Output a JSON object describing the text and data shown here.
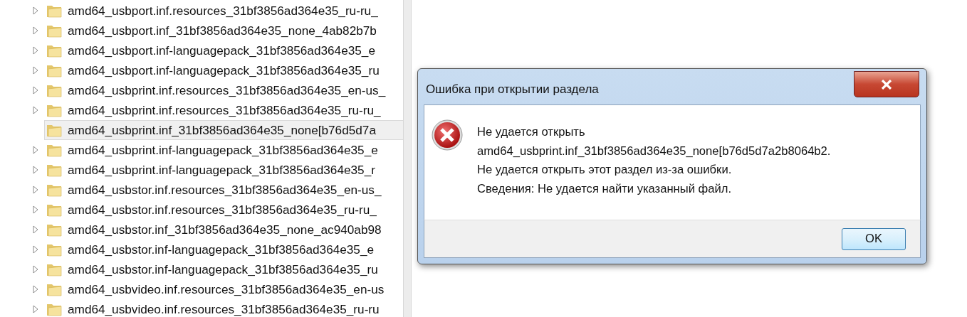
{
  "tree": {
    "items": [
      {
        "label": "amd64_usbport.inf.resources_31bf3856ad364e35_ru-ru_",
        "has_children": true,
        "selected": false
      },
      {
        "label": "amd64_usbport.inf_31bf3856ad364e35_none_4ab82b7b",
        "has_children": true,
        "selected": false
      },
      {
        "label": "amd64_usbport.inf-languagepack_31bf3856ad364e35_e",
        "has_children": true,
        "selected": false
      },
      {
        "label": "amd64_usbport.inf-languagepack_31bf3856ad364e35_ru",
        "has_children": true,
        "selected": false
      },
      {
        "label": "amd64_usbprint.inf.resources_31bf3856ad364e35_en-us_",
        "has_children": true,
        "selected": false
      },
      {
        "label": "amd64_usbprint.inf.resources_31bf3856ad364e35_ru-ru_",
        "has_children": true,
        "selected": false
      },
      {
        "label": "amd64_usbprint.inf_31bf3856ad364e35_none[b76d5d7a",
        "has_children": false,
        "selected": true
      },
      {
        "label": "amd64_usbprint.inf-languagepack_31bf3856ad364e35_e",
        "has_children": true,
        "selected": false
      },
      {
        "label": "amd64_usbprint.inf-languagepack_31bf3856ad364e35_r",
        "has_children": true,
        "selected": false
      },
      {
        "label": "amd64_usbstor.inf.resources_31bf3856ad364e35_en-us_",
        "has_children": true,
        "selected": false
      },
      {
        "label": "amd64_usbstor.inf.resources_31bf3856ad364e35_ru-ru_",
        "has_children": true,
        "selected": false
      },
      {
        "label": "amd64_usbstor.inf_31bf3856ad364e35_none_ac940ab98",
        "has_children": true,
        "selected": false
      },
      {
        "label": "amd64_usbstor.inf-languagepack_31bf3856ad364e35_e",
        "has_children": true,
        "selected": false
      },
      {
        "label": "amd64_usbstor.inf-languagepack_31bf3856ad364e35_ru",
        "has_children": true,
        "selected": false
      },
      {
        "label": "amd64_usbvideo.inf.resources_31bf3856ad364e35_en-us",
        "has_children": true,
        "selected": false
      },
      {
        "label": "amd64_usbvideo.inf.resources_31bf3856ad364e35_ru-ru",
        "has_children": true,
        "selected": false
      }
    ]
  },
  "dialog": {
    "title": "Ошибка при открытии раздела",
    "message_lines": [
      "Не удается открыть",
      "amd64_usbprint.inf_31bf3856ad364e35_none[b76d5d7a2b8064b2.",
      "Не удается открыть этот раздел из-за ошибки.",
      "Сведения: Не удается найти указанный файл."
    ],
    "buttons": [
      "OK"
    ]
  }
}
